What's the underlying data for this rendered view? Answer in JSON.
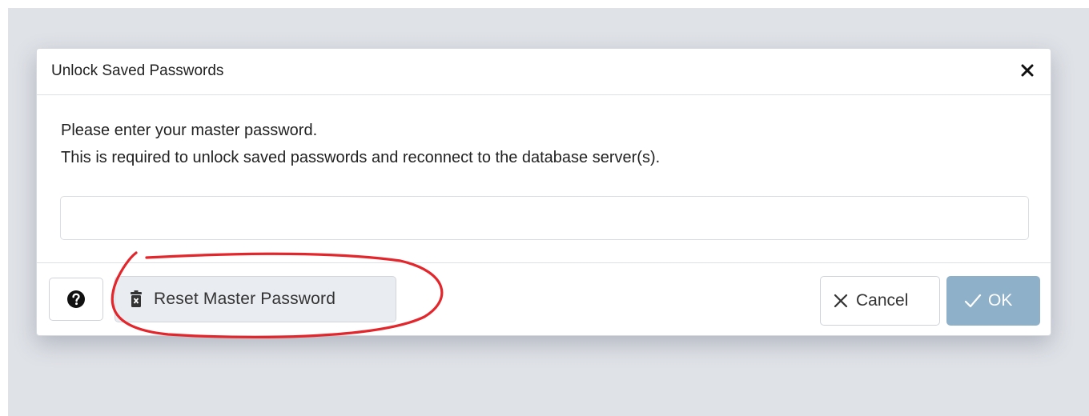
{
  "dialog": {
    "title": "Unlock Saved Passwords",
    "close_icon": "close-icon",
    "message_line1": "Please enter your master password.",
    "message_line2": "This is required to unlock saved passwords and reconnect to the database server(s).",
    "password_value": "",
    "password_placeholder": ""
  },
  "footer": {
    "help_icon": "question-circle-icon",
    "reset_icon": "trash-icon",
    "reset_label": "Reset Master Password",
    "cancel_icon": "x-icon",
    "cancel_label": "Cancel",
    "ok_icon": "check-icon",
    "ok_label": "OK"
  },
  "colors": {
    "backdrop": "#dfe2e7",
    "ok_button": "#8eb0c9",
    "reset_button": "#e9ecf0",
    "annotation_circle": "#e3262b"
  }
}
